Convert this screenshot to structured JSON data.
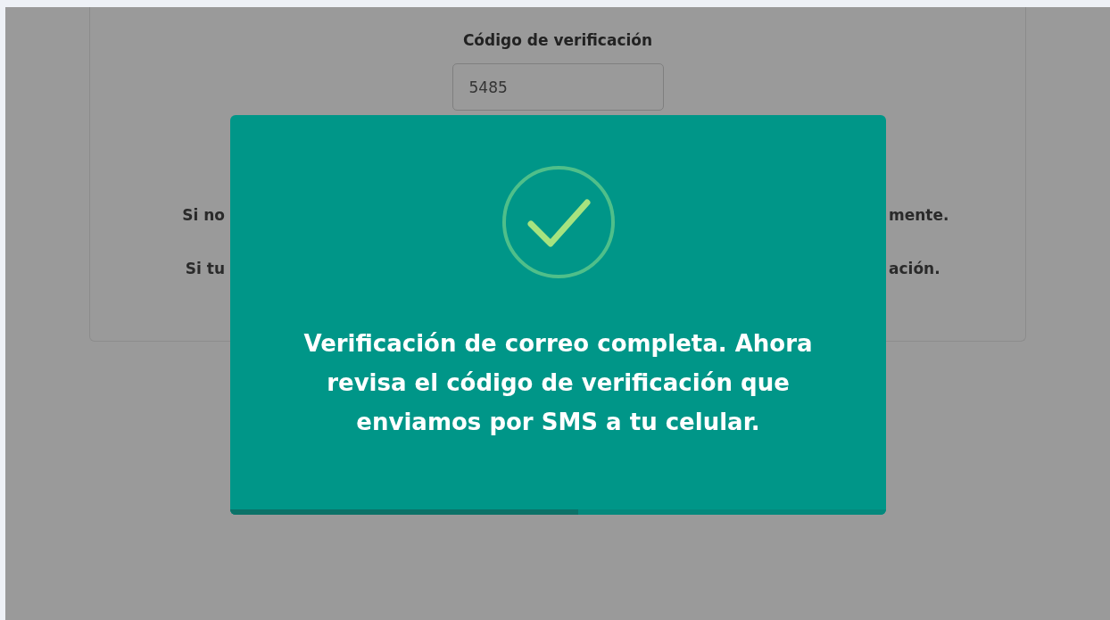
{
  "form": {
    "label": "Código de verificación",
    "code_value": "5485",
    "notes": [
      {
        "left": "Si no",
        "right": "mente."
      },
      {
        "left": "Si tu",
        "right": "ación."
      }
    ]
  },
  "dialog": {
    "message": "Verificación de correo completa. Ahora revisa el código de verificación que enviamos por SMS a tu celular.",
    "progress": {
      "level": 0.53
    }
  }
}
